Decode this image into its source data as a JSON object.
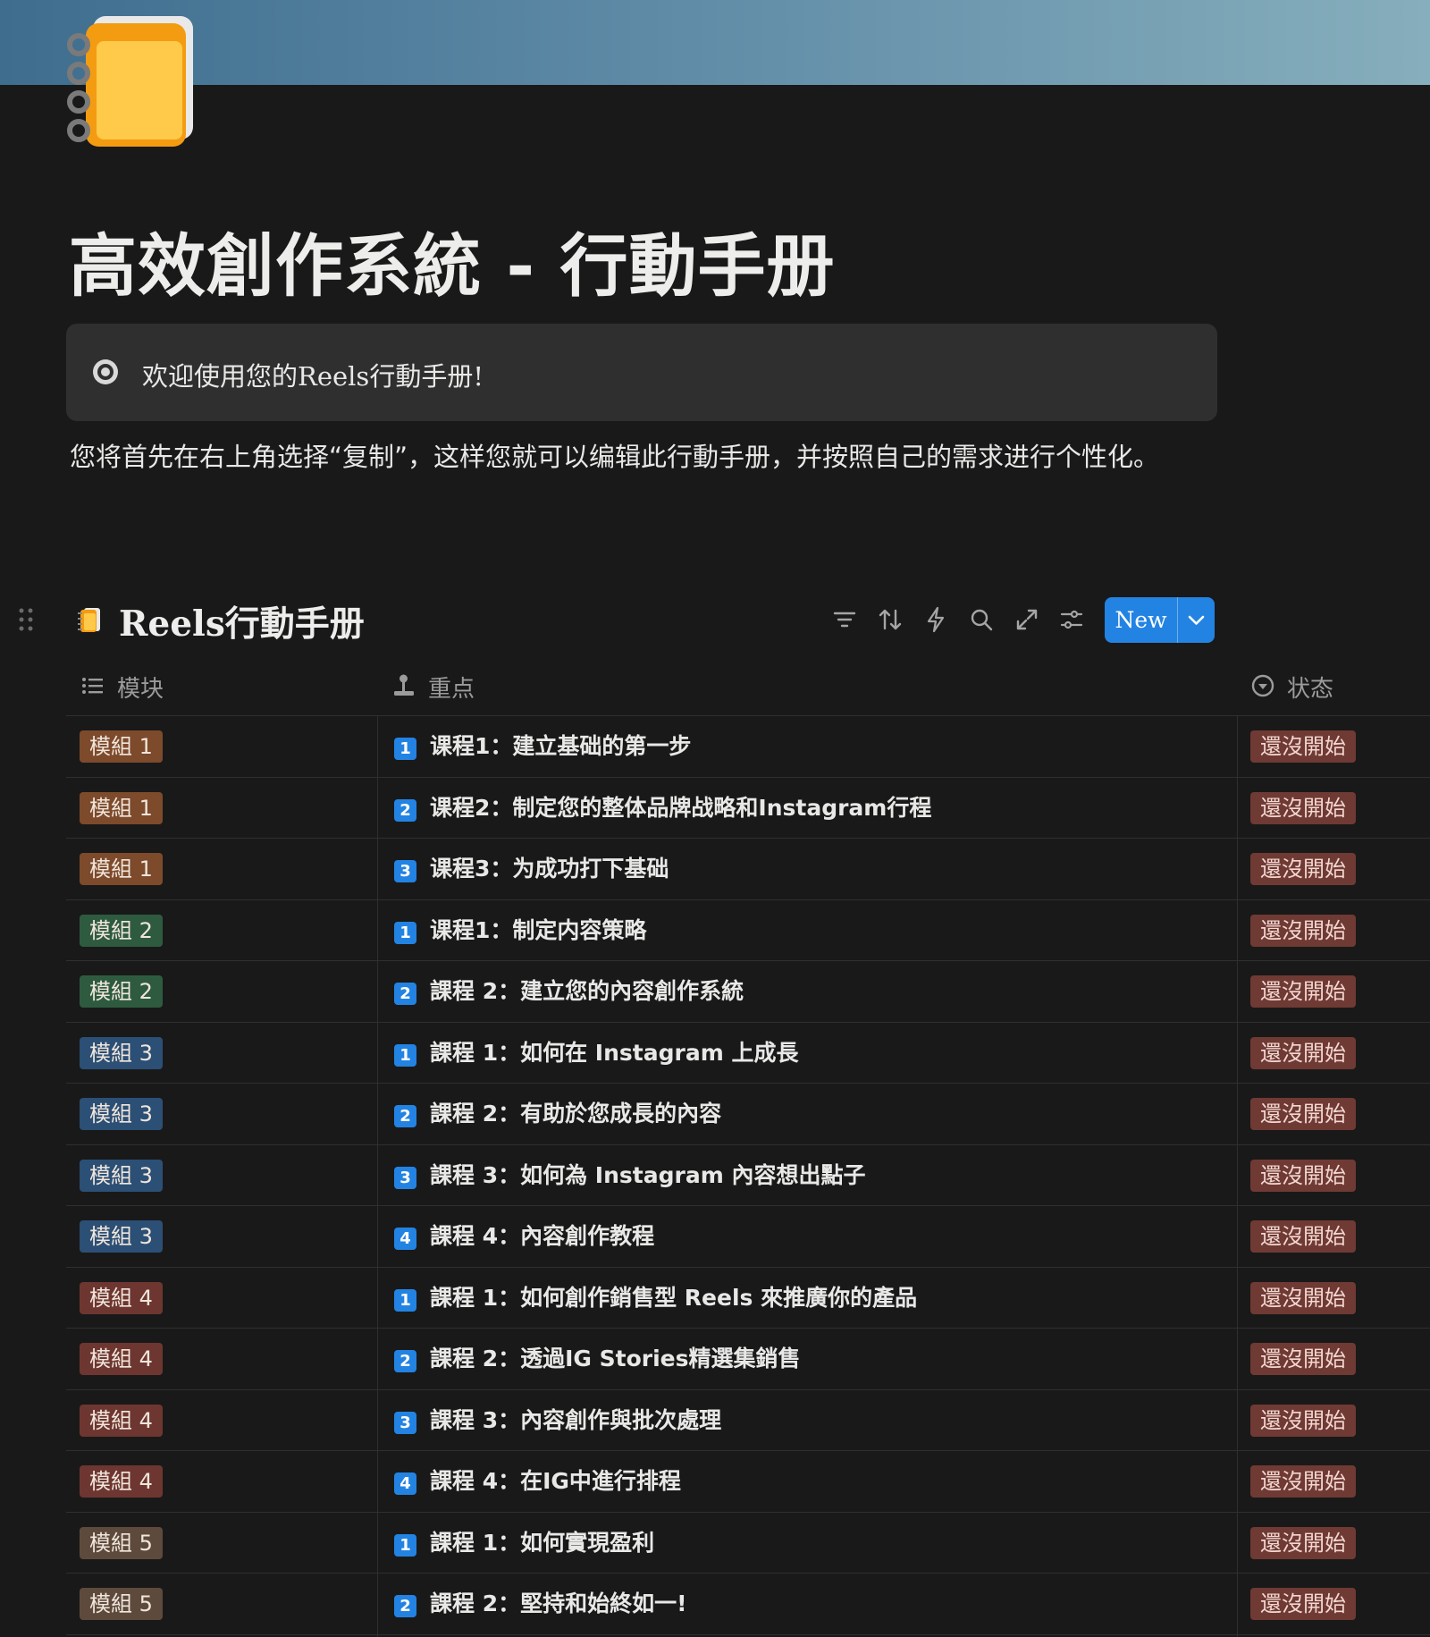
{
  "page": {
    "title": "高效創作系統 - 行動手册",
    "icon": "spiral-notebook-icon"
  },
  "callout": {
    "icon": "target-icon",
    "text": "欢迎使用您的Reels行動手册!"
  },
  "paragraph": "您将首先在右上角选择“复制”，这样您就可以编辑此行動手册，并按照自己的需求进行个性化。",
  "database": {
    "title": "Reels行動手册",
    "icon": "notebook-icon",
    "toolbar": [
      "filter-icon",
      "sort-icon",
      "automation-icon",
      "search-icon",
      "expand-icon",
      "settings-icon"
    ],
    "new_label": "New",
    "columns": [
      {
        "label": "模块",
        "icon": "list-icon"
      },
      {
        "label": "重点",
        "icon": "joystick-icon"
      },
      {
        "label": "状态",
        "icon": "status-icon"
      }
    ],
    "rows": [
      {
        "module": "模組 1",
        "color": "#7d4a2b",
        "num": "1",
        "lesson": "课程1：建立基础的第一步",
        "status": "還沒開始"
      },
      {
        "module": "模組 1",
        "color": "#7d4a2b",
        "num": "2",
        "lesson": "课程2：制定您的整体品牌战略和Instagram行程",
        "status": "還沒開始"
      },
      {
        "module": "模組 1",
        "color": "#7d4a2b",
        "num": "3",
        "lesson": "课程3：为成功打下基础",
        "status": "還沒開始"
      },
      {
        "module": "模組 2",
        "color": "#2e5b40",
        "num": "1",
        "lesson": "课程1：制定内容策略",
        "status": "還沒開始"
      },
      {
        "module": "模組 2",
        "color": "#2e5b40",
        "num": "2",
        "lesson": "課程 2：建立您的內容創作系統",
        "status": "還沒開始"
      },
      {
        "module": "模組 3",
        "color": "#2c4f75",
        "num": "1",
        "lesson": "課程 1：如何在 Instagram 上成長",
        "status": "還沒開始"
      },
      {
        "module": "模組 3",
        "color": "#2c4f75",
        "num": "2",
        "lesson": "課程 2：有助於您成長的內容",
        "status": "還沒開始"
      },
      {
        "module": "模組 3",
        "color": "#2c4f75",
        "num": "3",
        "lesson": "課程 3：如何為 Instagram 內容想出點子",
        "status": "還沒開始"
      },
      {
        "module": "模組 3",
        "color": "#2c4f75",
        "num": "4",
        "lesson": "課程 4：內容創作教程",
        "status": "還沒開始"
      },
      {
        "module": "模組 4",
        "color": "#6e3630",
        "num": "1",
        "lesson": "課程 1：如何創作銷售型 Reels 來推廣你的產品",
        "status": "還沒開始"
      },
      {
        "module": "模組 4",
        "color": "#6e3630",
        "num": "2",
        "lesson": "課程 2：透過IG Stories精選集銷售",
        "status": "還沒開始"
      },
      {
        "module": "模組 4",
        "color": "#6e3630",
        "num": "3",
        "lesson": "課程 3：內容創作與批次處理",
        "status": "還沒開始"
      },
      {
        "module": "模組 4",
        "color": "#6e3630",
        "num": "4",
        "lesson": "課程 4：在IG中進行排程",
        "status": "還沒開始"
      },
      {
        "module": "模組 5",
        "color": "#5e4a3c",
        "num": "1",
        "lesson": "課程 1：如何實現盈利",
        "status": "還沒開始"
      },
      {
        "module": "模組 5",
        "color": "#5e4a3c",
        "num": "2",
        "lesson": "課程 2：堅持和始終如一!",
        "status": "還沒開始"
      }
    ]
  }
}
